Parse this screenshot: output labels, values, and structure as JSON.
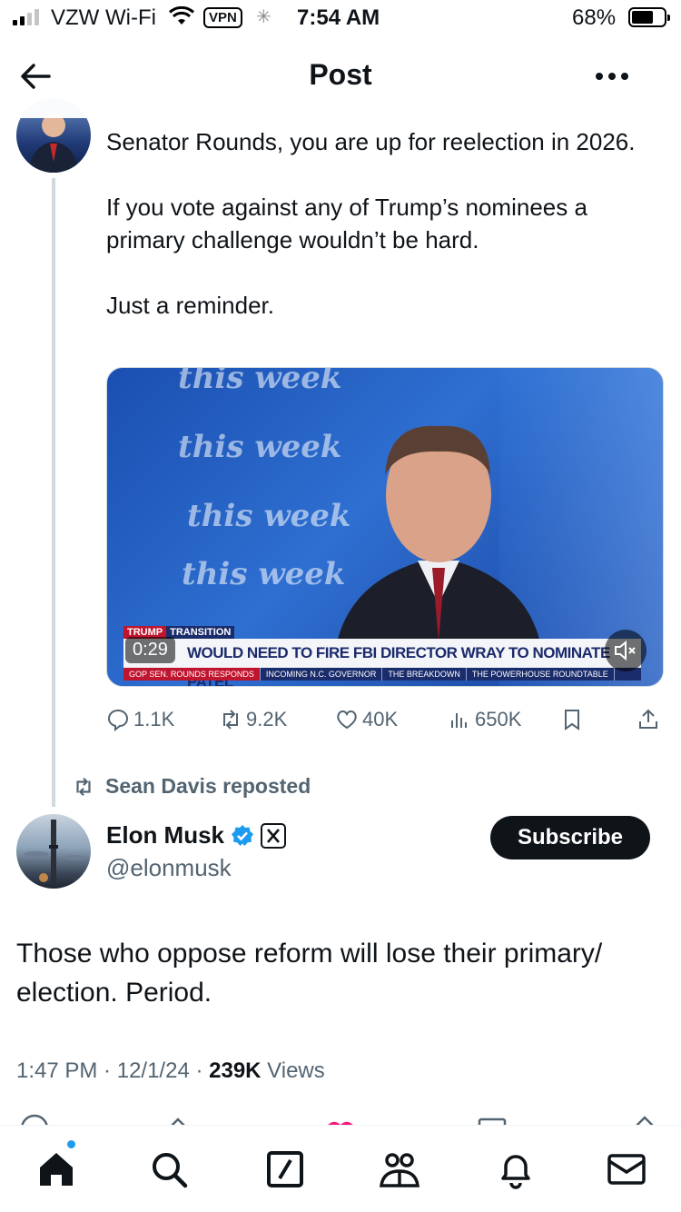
{
  "status_bar": {
    "carrier": "VZW Wi-Fi",
    "vpn": "VPN",
    "time": "7:54 AM",
    "battery_pct": "68%",
    "battery_level": 0.68
  },
  "header": {
    "title": "Post"
  },
  "quoted_tweet": {
    "text_lines": [
      "Senator Rounds, you are up for reelection in 2026.",
      "If you vote against any of Trump’s nominees a primary challenge wouldn’t be hard.",
      "Just a reminder."
    ],
    "video": {
      "duration": "0:29",
      "watermark": "this week",
      "tag_a": "TRUMP",
      "tag_b": "TRANSITION",
      "headline": "WOULD NEED TO FIRE FBI DIRECTOR WRAY TO NOMINATE PATEL",
      "ticker": [
        "GOP SEN. ROUNDS RESPONDS",
        "INCOMING N.C. GOVERNOR",
        "THE BREAKDOWN",
        "THE POWERHOUSE ROUNDTABLE"
      ]
    },
    "stats": {
      "replies": "1.1K",
      "reposts": "9.2K",
      "likes": "40K",
      "views": "650K"
    }
  },
  "repost_label": "Sean Davis reposted",
  "post": {
    "author_name": "Elon Musk",
    "author_handle": "@elonmusk",
    "subscribe_label": "Subscribe",
    "text": "Those who oppose reform will lose their primary/ election. Period.",
    "time": "1:47 PM",
    "date": "12/1/24",
    "views_count": "239K",
    "views_label": "Views"
  },
  "colors": {
    "accent": "#1d9bf0",
    "muted": "#536471",
    "verified": "#1d9bf0"
  },
  "tabs": [
    "home-icon",
    "search-icon",
    "grok-icon",
    "communities-icon",
    "notifications-icon",
    "messages-icon"
  ]
}
